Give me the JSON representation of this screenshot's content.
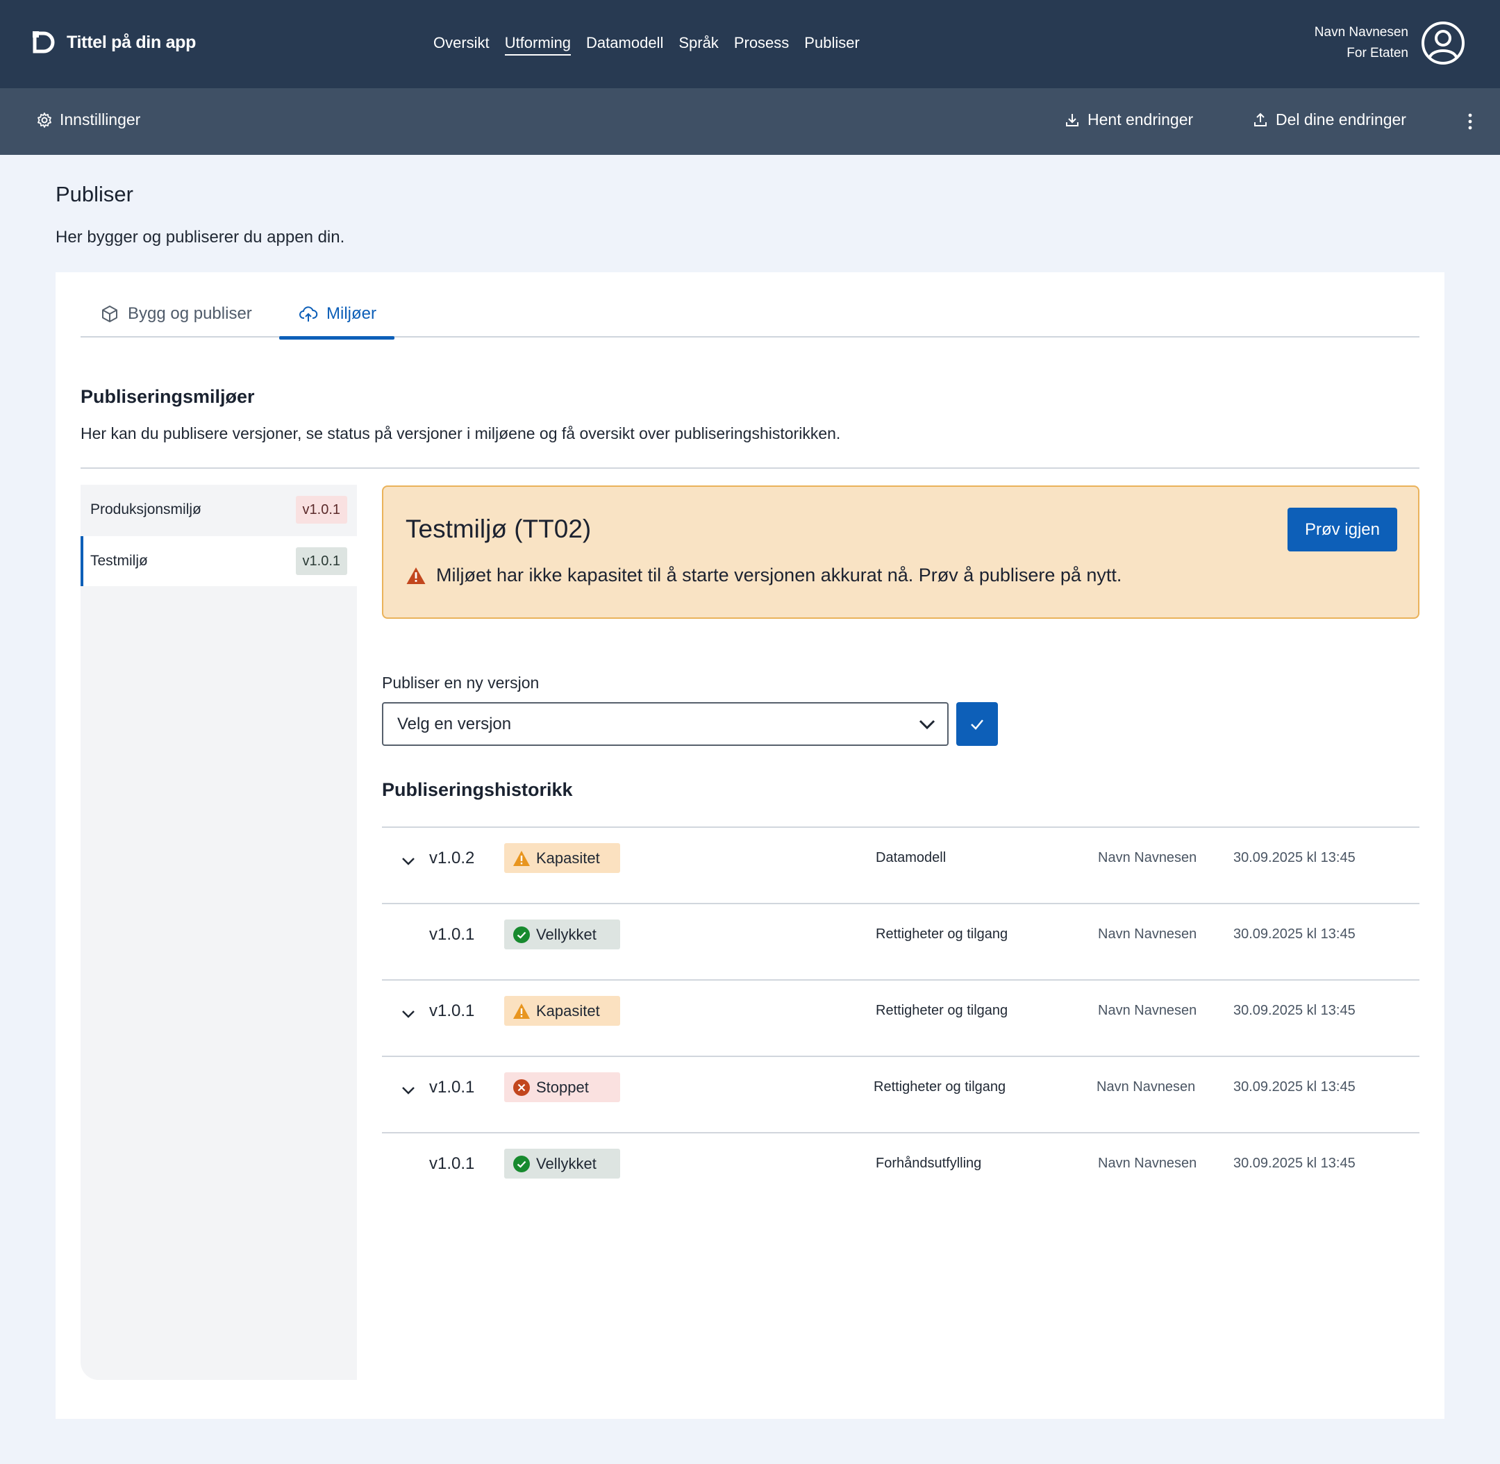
{
  "header": {
    "app_title": "Tittel på din app",
    "nav": [
      "Oversikt",
      "Utforming",
      "Datamodell",
      "Språk",
      "Prosess",
      "Publiser"
    ],
    "active_nav": "Utforming",
    "user_name": "Navn Navnesen",
    "user_org": "For Etaten"
  },
  "subbar": {
    "settings": "Innstillinger",
    "fetch": "Hent endringer",
    "share": "Del dine endringer"
  },
  "page": {
    "title": "Publiser",
    "subtitle": "Her bygger og publiserer du appen din."
  },
  "tabs": [
    {
      "label": "Bygg og publiser",
      "icon": "package-icon",
      "active": false
    },
    {
      "label": "Miljøer",
      "icon": "cloud-upload-icon",
      "active": true
    }
  ],
  "section": {
    "title": "Publiseringsmiljøer",
    "description": "Her kan du publisere versjoner, se status på versjoner i miljøene og få oversikt over publiseringshistorikken."
  },
  "environments": [
    {
      "name": "Produksjonsmiljø",
      "version": "v1.0.1",
      "selected": false
    },
    {
      "name": "Testmiljø",
      "version": "v1.0.1",
      "selected": true
    }
  ],
  "alert": {
    "title": "Testmiljø (TT02)",
    "message": "Miljøet har ikke kapasitet til å starte versjonen akkurat nå. Prøv å publisere på nytt.",
    "button": "Prøv igjen"
  },
  "publish": {
    "label": "Publiser en ny versjon",
    "placeholder": "Velg en versjon"
  },
  "history": {
    "title": "Publiseringshistorikk",
    "rows": [
      {
        "version": "v1.0.2",
        "status": "Kapasitet",
        "status_type": "warn",
        "expandable": true,
        "area": "Datamodell",
        "user": "Navn Navnesen",
        "time": "30.09.2025 kl 13:45"
      },
      {
        "version": "v1.0.1",
        "status": "Vellykket",
        "status_type": "ok",
        "expandable": false,
        "area": "Rettigheter og tilgang",
        "user": "Navn Navnesen",
        "time": "30.09.2025 kl 13:45"
      },
      {
        "version": "v1.0.1",
        "status": "Kapasitet",
        "status_type": "warn",
        "expandable": true,
        "area": "Rettigheter og tilgang",
        "user": "Navn Navnesen",
        "time": "30.09.2025 kl 13:45"
      },
      {
        "version": "v1.0.1",
        "status": "Stoppet",
        "status_type": "stop",
        "expandable": true,
        "area": "Rettigheter og tilgang",
        "user": "Navn Navnesen",
        "time": "30.09.2025 kl 13:45"
      },
      {
        "version": "v1.0.1",
        "status": "Vellykket",
        "status_type": "ok",
        "expandable": false,
        "area": "Forhåndsutfylling",
        "user": "Navn Navnesen",
        "time": "30.09.2025 kl 13:45"
      }
    ]
  },
  "colors": {
    "header_bg": "#283a52",
    "subbar_bg": "#3f5065",
    "accent": "#0d5fb8",
    "warning_bg": "#f9e3c4",
    "warning_border": "#eab25a",
    "success": "#178a2e",
    "danger": "#c0392b"
  }
}
